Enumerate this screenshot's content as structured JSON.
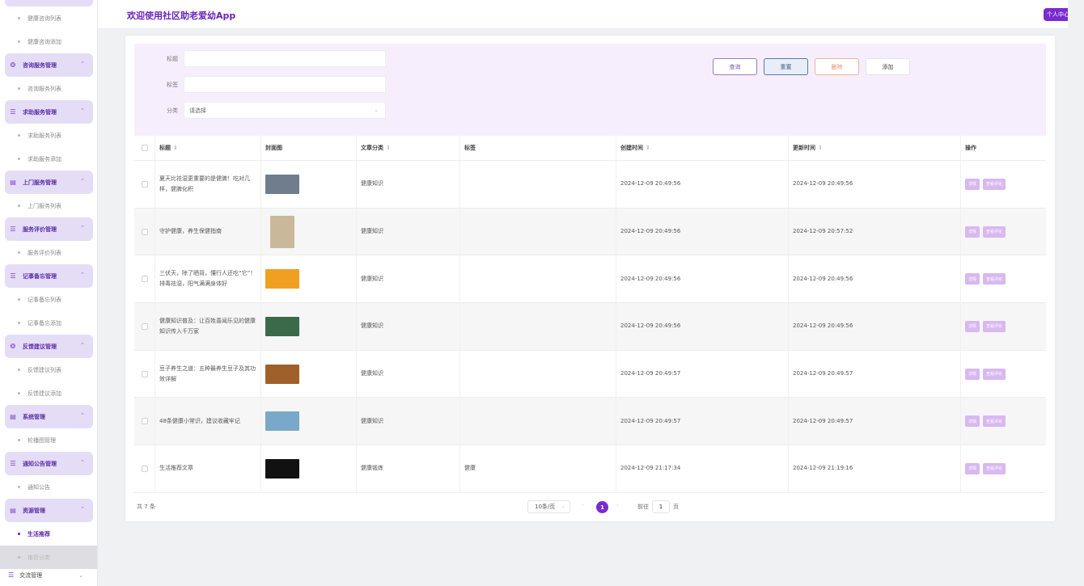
{
  "header": {
    "title": "欢迎使用社区助老爱幼App",
    "user_center": "个人中心"
  },
  "sidebar": {
    "top_items": [
      "健康咨询列表",
      "健康咨询添加"
    ],
    "groups": [
      {
        "label": "咨询服务管理",
        "icon": "drop-icon",
        "items": [
          "咨询服务列表"
        ]
      },
      {
        "label": "求助服务管理",
        "icon": "list-icon",
        "items": [
          "求助服务列表",
          "求助服务添加"
        ]
      },
      {
        "label": "上门服务管理",
        "icon": "doc-icon",
        "items": [
          "上门服务列表"
        ]
      },
      {
        "label": "服务评价管理",
        "icon": "list-icon",
        "items": [
          "服务评价列表"
        ]
      },
      {
        "label": "记事备忘管理",
        "icon": "list-icon",
        "items": [
          "记事备忘列表",
          "记事备忘添加"
        ]
      },
      {
        "label": "反馈建议管理",
        "icon": "drop-icon",
        "items": [
          "反馈建议列表",
          "反馈建议添加"
        ]
      },
      {
        "label": "系统管理",
        "icon": "doc-icon",
        "items": [
          "轮播图管理"
        ]
      },
      {
        "label": "通知公告管理",
        "icon": "list-icon",
        "items": [
          "通知公告"
        ]
      },
      {
        "label": "资源管理",
        "icon": "doc-icon",
        "items": [
          "生活推荐",
          "推荐分类"
        ]
      }
    ],
    "last_group": "交流管理"
  },
  "filter": {
    "title_label": "标题",
    "title_value": "",
    "tag_label": "标签",
    "tag_value": "",
    "category_label": "分类",
    "category_placeholder": "请选择",
    "btn_query": "查询",
    "btn_reset": "重置",
    "btn_delete": "删除",
    "btn_add": "添加"
  },
  "table": {
    "headers": [
      "标题",
      "封面图",
      "文章分类",
      "标签",
      "创建时间",
      "更新时间",
      "操作"
    ],
    "rows": [
      {
        "title": "夏天比祛湿更重要的是健脾！吃对几样，健脾化积",
        "category": "健康知识",
        "tag": "",
        "created": "2024-12-09 20:49:56",
        "updated": "2024-12-09 20:49:56",
        "thumb_color": "#6f7d8c"
      },
      {
        "title": "守护健康，养生保健指南",
        "category": "健康知识",
        "tag": "",
        "created": "2024-12-09 20:49:56",
        "updated": "2024-12-09 20:57:52",
        "thumb_color": "#c9b89a"
      },
      {
        "title": "三伏天，除了晒背，懂行人还吃“它”！排毒祛湿，阳气满满身体好",
        "category": "健康知识",
        "tag": "",
        "created": "2024-12-09 20:49:56",
        "updated": "2024-12-09 20:49:56",
        "thumb_color": "#f0a020"
      },
      {
        "title": "健康知识普及：让百姓喜闻乐见的健康知识传入千万家",
        "category": "健康知识",
        "tag": "",
        "created": "2024-12-09 20:49:56",
        "updated": "2024-12-09 20:49:56",
        "thumb_color": "#3a6a4a"
      },
      {
        "title": "豆子养生之道：五种最养生豆子及其功效详解",
        "category": "健康知识",
        "tag": "",
        "created": "2024-12-09 20:49:57",
        "updated": "2024-12-09 20:49:57",
        "thumb_color": "#a0602a"
      },
      {
        "title": "48条健康小常识，建议收藏牢记",
        "category": "健康知识",
        "tag": "",
        "created": "2024-12-09 20:49:57",
        "updated": "2024-12-09 20:49:57",
        "thumb_color": "#7aa8c8"
      },
      {
        "title": "生活推荐文章",
        "category": "健康锻炼",
        "tag": "健康",
        "created": "2024-12-09 21:17:34",
        "updated": "2024-12-09 21:19:16",
        "thumb_color": "#111111"
      }
    ],
    "action_detail": "详情",
    "action_view_comments": "查看评论"
  },
  "pagination": {
    "total": "共 7 条",
    "page_size": "10条/页",
    "current_page": "1",
    "goto_label": "前往",
    "goto_value": "1",
    "page_suffix": "页"
  },
  "colors": {
    "accent": "#7a2bd1",
    "filter_bg": "#f7eefd",
    "sidebar_group_bg": "#e5dcf6"
  }
}
